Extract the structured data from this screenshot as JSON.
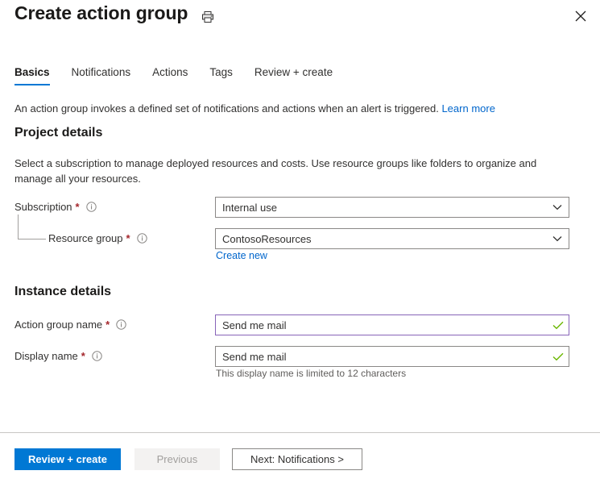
{
  "header": {
    "title": "Create action group",
    "print_icon": "printer-icon",
    "close_icon": "close-icon"
  },
  "tabs": [
    {
      "label": "Basics",
      "active": true
    },
    {
      "label": "Notifications",
      "active": false
    },
    {
      "label": "Actions",
      "active": false
    },
    {
      "label": "Tags",
      "active": false
    },
    {
      "label": "Review + create",
      "active": false
    }
  ],
  "intro": {
    "text": "An action group invokes a defined set of notifications and actions when an alert is triggered.",
    "link_label": "Learn more"
  },
  "project_details": {
    "heading": "Project details",
    "description": "Select a subscription to manage deployed resources and costs. Use resource groups like folders to organize and manage all your resources.",
    "subscription": {
      "label": "Subscription",
      "required": "*",
      "info_icon": "info-icon",
      "value": "Internal use",
      "options": [
        "Internal use"
      ],
      "chevron_icon": "chevron-down-icon"
    },
    "resource_group": {
      "label": "Resource group",
      "required": "*",
      "info_icon": "info-icon",
      "value": "ContosoResources",
      "options": [
        "ContosoResources"
      ],
      "chevron_icon": "chevron-down-icon",
      "create_new_label": "Create new"
    }
  },
  "instance_details": {
    "heading": "Instance details",
    "action_group_name": {
      "label": "Action group name",
      "required": "*",
      "info_icon": "info-icon",
      "value": "Send me mail",
      "placeholder": "",
      "valid_icon": "checkmark-icon",
      "focused": true
    },
    "display_name": {
      "label": "Display name",
      "required": "*",
      "info_icon": "info-icon",
      "value": "Send me mail",
      "placeholder": "",
      "valid_icon": "checkmark-icon",
      "helper_text": "This display name is limited to 12 characters"
    }
  },
  "footer": {
    "review_create_label": "Review + create",
    "previous_label": "Previous",
    "next_label": "Next: Notifications >"
  },
  "colors": {
    "accent_blue": "#0078d4",
    "link_blue": "#0066cc",
    "required_red": "#a4262c",
    "valid_green": "#6bb700",
    "focus_purple": "#8764b8",
    "border_gray": "#8a8886"
  }
}
